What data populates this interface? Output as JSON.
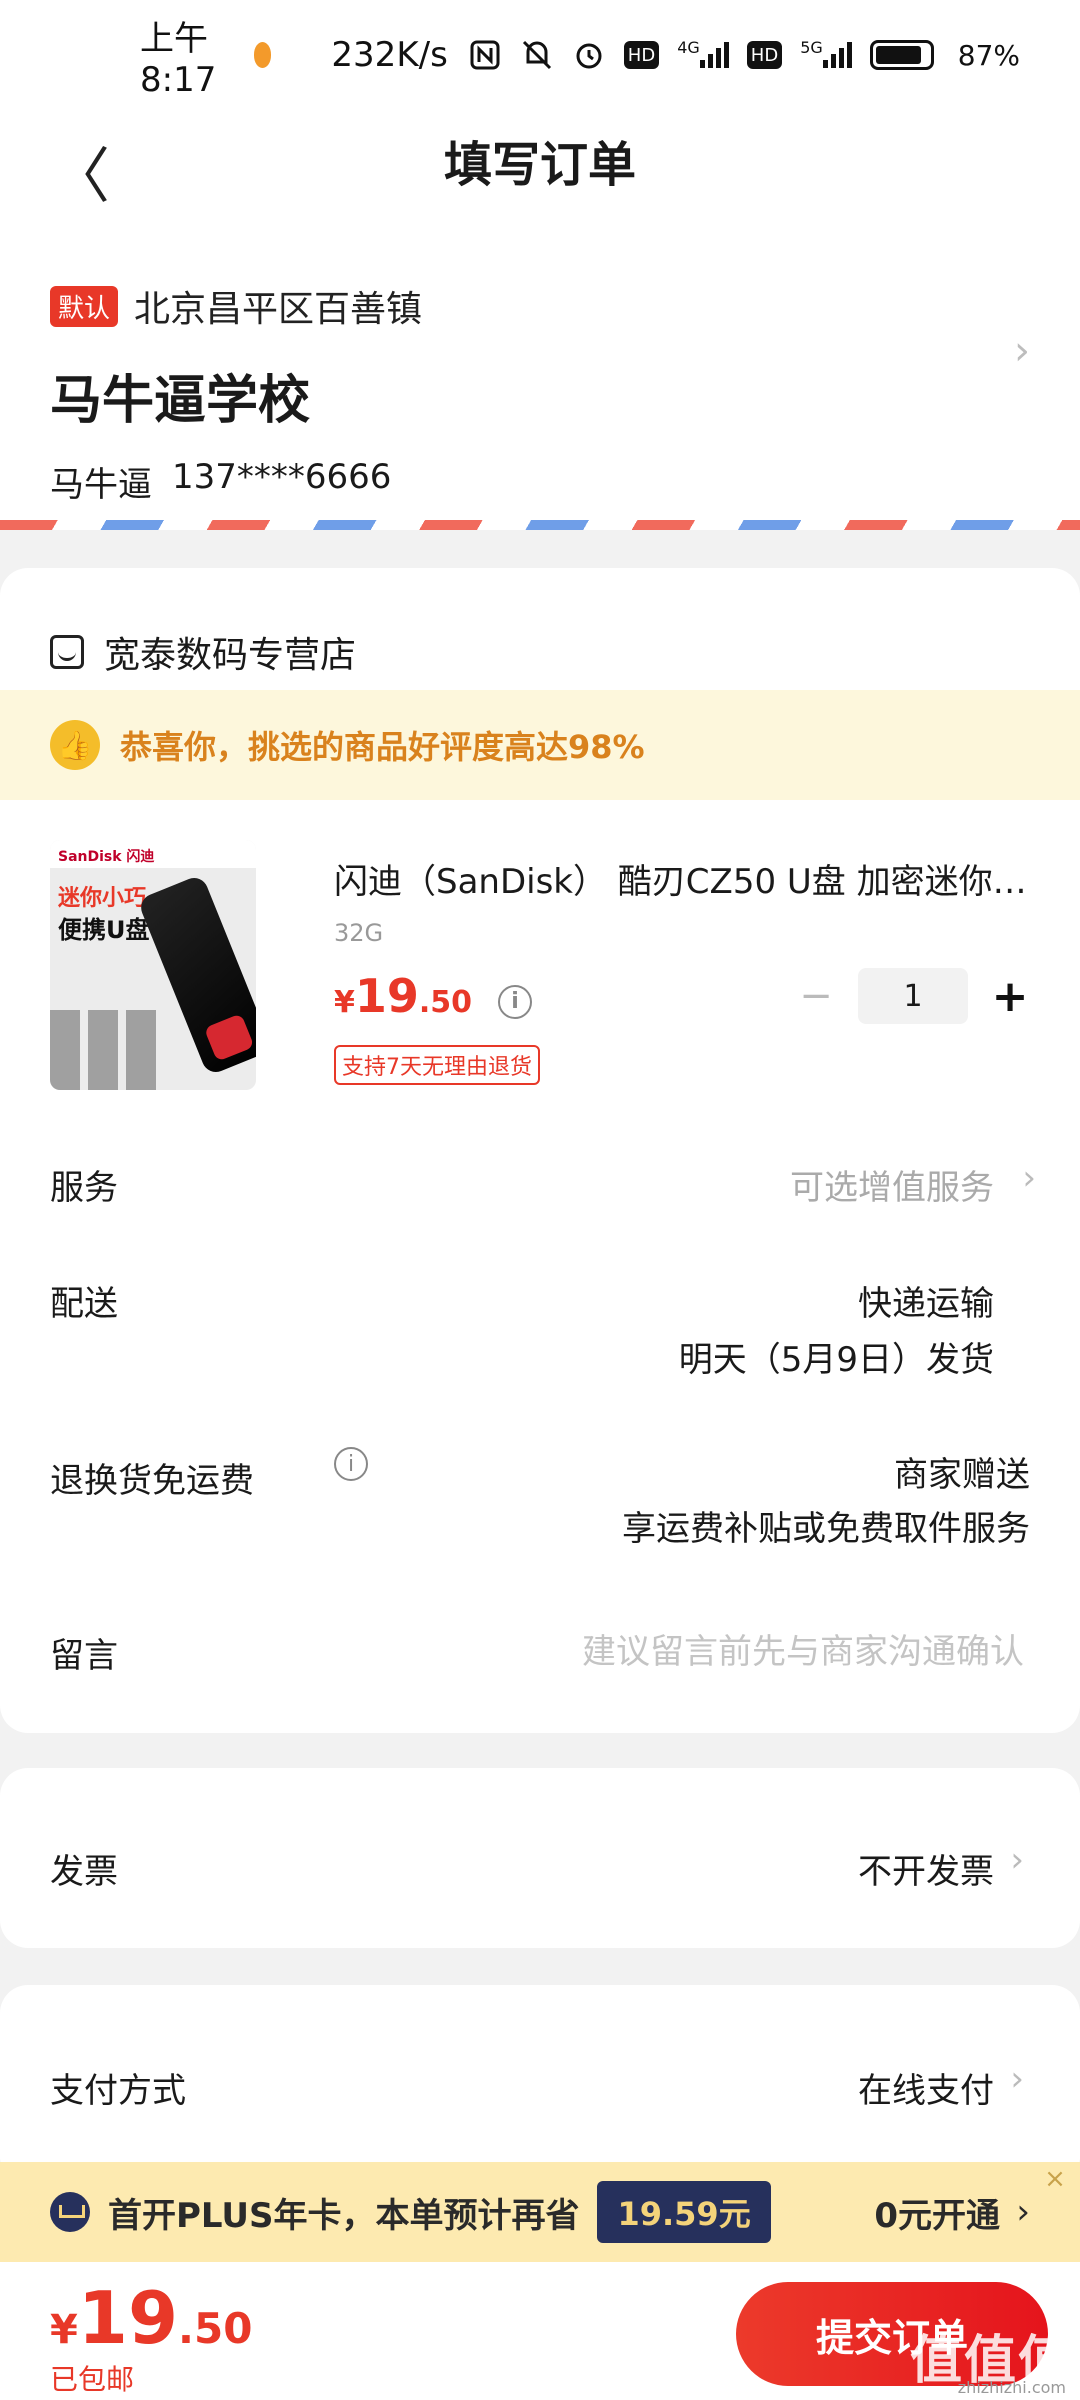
{
  "status_bar": {
    "time": "上午8:17",
    "net_speed": "232K/s",
    "signal_4g": "4G",
    "signal_5g": "5G",
    "hd1": "HD",
    "hd2": "HD",
    "battery_text": "87%",
    "battery_level": 0.87
  },
  "header": {
    "back_glyph": "〈",
    "title": "填写订单"
  },
  "address": {
    "default_tag": "默认",
    "region": "北京昌平区百善镇",
    "place": "马牛逼学校",
    "recipient": "马牛逼",
    "phone": "137****6666"
  },
  "store": {
    "name": "宽泰数码专营店",
    "praise": "恭喜你，挑选的商品好评度高达98%",
    "product": {
      "image_brand": "SanDisk 闪迪",
      "image_slogan1": "迷你小巧",
      "image_slogan2": "便携U盘",
      "title": "闪迪（SanDisk） 酷刃CZ50 U盘 加密迷你…",
      "spec": "32G",
      "price_symbol": "¥",
      "price_int": "19",
      "price_dec": ".50",
      "return_tag": "支持7天无理由退货",
      "quantity": "1",
      "minus": "−",
      "plus": "+"
    },
    "rows": {
      "service_label": "服务",
      "service_value": "可选增值服务",
      "delivery_label": "配送",
      "delivery_method": "快递运输",
      "delivery_date": "明天（5月9日）发货",
      "return_label": "退换货免运费",
      "return_value1": "商家赠送",
      "return_value2": "享运费补贴或免费取件服务",
      "message_label": "留言",
      "message_placeholder": "建议留言前先与商家沟通确认"
    }
  },
  "invoice": {
    "label": "发票",
    "value": "不开发票"
  },
  "payment": {
    "label": "支付方式",
    "value": "在线支付"
  },
  "plus_banner": {
    "text": "首开PLUS年卡，本单预计再省",
    "save_amount": "19.59元",
    "open_text": "0元开通",
    "close_glyph": "×"
  },
  "bottom": {
    "price_symbol": "¥",
    "price_int": "19",
    "price_dec": ".50",
    "shipping": "已包邮",
    "submit": "提交订单"
  },
  "watermark": {
    "text": "值值值",
    "url": "zhizhizhi.com"
  },
  "colors": {
    "accent_red": "#e83828",
    "praise_orange": "#d9821d",
    "plus_navy": "#26305c"
  }
}
